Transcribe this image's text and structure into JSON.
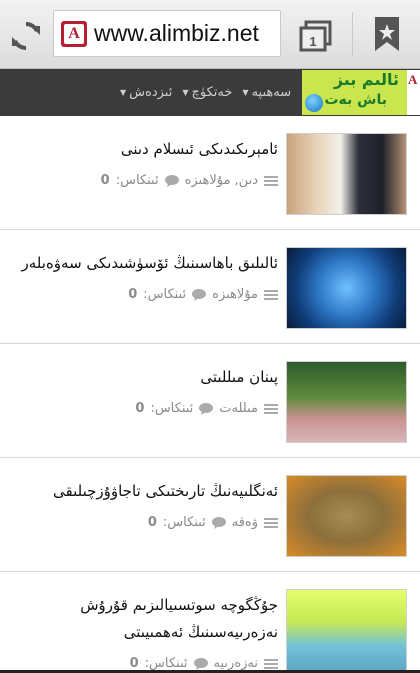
{
  "browser": {
    "url": "www.alimbiz.net",
    "site_icon_letter": "A",
    "tab_count": "1"
  },
  "nav": {
    "items": [
      {
        "label": "سەھىپە"
      },
      {
        "label": "خەتكۈچ"
      },
      {
        "label": "ئىزدەش"
      }
    ],
    "logo_line1": "ئالىم بىز",
    "logo_line2": "باش بەت",
    "logo_letter": "A"
  },
  "articles": [
    {
      "title": "ئامېرىكىدىكى ئىسلام دىنى",
      "category": "دىن, مۇلاھىزە",
      "comments_label": "ئىنكاس:",
      "comments_count": "0"
    },
    {
      "title": "ئالىلىق باھاسىنىڭ ئۆسۈشىدىكى سەۋەبلەر",
      "category": "مۇلاھىزە",
      "comments_label": "ئىنكاس:",
      "comments_count": "0"
    },
    {
      "title": "پىنان مىللىتى",
      "category": "مىللەت",
      "comments_label": "ئىنكاس:",
      "comments_count": "0"
    },
    {
      "title": "ئەنگلىيەنىڭ تارىختىكى تاجاۋۇزچىلىقى",
      "category": "ۋەقە",
      "comments_label": "ئىنكاس:",
      "comments_count": "0"
    },
    {
      "title": "جۇڭگوچە سوتسىيالىزىم قۇرۇش نەزەرىيەسىنىڭ ئەھمىيىتى",
      "category": "نەزەرىيە",
      "comments_label": "ئىنكاس:",
      "comments_count": "0"
    }
  ],
  "colors": {
    "nav_bg": "#3b3b3b",
    "logo_bg": "#c9e64e",
    "logo_text": "#1a7a2a",
    "site_icon": "#b41f33"
  }
}
